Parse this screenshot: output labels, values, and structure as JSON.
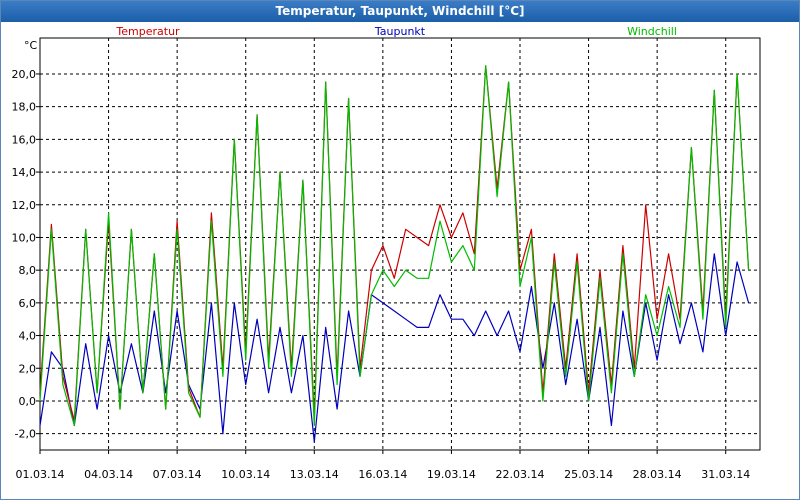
{
  "window": {
    "title": "Temperatur, Taupunkt, Windchill [°C]"
  },
  "colors": {
    "Temperatur": "#cc0000",
    "Taupunkt": "#0000bb",
    "Windchill": "#00bb00",
    "grid": "#000000",
    "title_bar": "#2a6db5"
  },
  "chart_data": {
    "type": "line",
    "title": "Temperatur, Taupunkt, Windchill [°C]",
    "ylabel": "°C",
    "ylim": [
      -3.0,
      22.2
    ],
    "xlim": [
      "01.03.14",
      "02.04.14"
    ],
    "yticks": [
      "-2,0",
      "0,0",
      "2,0",
      "4,0",
      "6,0",
      "8,0",
      "10,0",
      "12,0",
      "14,0",
      "16,0",
      "18,0",
      "20,0"
    ],
    "xticks": [
      "01.03.14",
      "04.03.14",
      "07.03.14",
      "10.03.14",
      "13.03.14",
      "16.03.14",
      "19.03.14",
      "22.03.14",
      "25.03.14",
      "28.03.14",
      "31.03.14"
    ],
    "grid": true,
    "legend": "top",
    "x_unit": "day of month (March 2014), 0.5-day steps starting 01.03.14",
    "x": [
      1.0,
      1.5,
      2.0,
      2.5,
      3.0,
      3.5,
      4.0,
      4.5,
      5.0,
      5.5,
      6.0,
      6.5,
      7.0,
      7.5,
      8.0,
      8.5,
      9.0,
      9.5,
      10.0,
      10.5,
      11.0,
      11.5,
      12.0,
      12.5,
      13.0,
      13.5,
      14.0,
      14.5,
      15.0,
      15.5,
      16.0,
      16.5,
      17.0,
      17.5,
      18.0,
      18.5,
      19.0,
      19.5,
      20.0,
      20.5,
      21.0,
      21.5,
      22.0,
      22.5,
      23.0,
      23.5,
      24.0,
      24.5,
      25.0,
      25.5,
      26.0,
      26.5,
      27.0,
      27.5,
      28.0,
      28.5,
      29.0,
      29.5,
      30.0,
      30.5,
      31.0,
      31.5,
      32.0
    ],
    "series": [
      {
        "name": "Temperatur",
        "values": [
          0.5,
          10.8,
          1.5,
          -1.2,
          10.5,
          0.5,
          11.0,
          -0.5,
          10.5,
          0.5,
          9.0,
          -0.5,
          11.0,
          0.8,
          -1.0,
          11.5,
          2.0,
          16.0,
          3.0,
          17.5,
          2.5,
          14.0,
          2.0,
          13.5,
          -1.0,
          19.5,
          1.5,
          18.5,
          2.0,
          8.0,
          9.5,
          7.5,
          10.5,
          10.0,
          9.5,
          12.0,
          10.0,
          11.5,
          9.0,
          20.5,
          13.0,
          19.5,
          8.0,
          10.5,
          0.5,
          9.0,
          2.0,
          9.0,
          0.5,
          8.0,
          1.0,
          9.5,
          2.0,
          12.0,
          5.0,
          9.0,
          5.0,
          15.5,
          5.5,
          19.0,
          5.0,
          20.0,
          8.0
        ]
      },
      {
        "name": "Taupunkt",
        "values": [
          -1.5,
          3.0,
          2.0,
          -1.5,
          3.5,
          -0.5,
          4.0,
          0.5,
          3.5,
          0.5,
          5.5,
          0.5,
          5.5,
          1.0,
          -0.5,
          6.0,
          -2.0,
          6.0,
          1.0,
          5.0,
          0.5,
          4.5,
          0.5,
          4.0,
          -2.5,
          4.5,
          -0.5,
          5.5,
          1.5,
          6.5,
          6.0,
          5.5,
          5.0,
          4.5,
          4.5,
          6.5,
          5.0,
          5.0,
          4.0,
          5.5,
          4.0,
          5.5,
          3.0,
          7.0,
          2.0,
          6.0,
          1.0,
          5.0,
          0.0,
          4.5,
          -1.5,
          5.5,
          1.5,
          6.0,
          2.5,
          6.5,
          3.5,
          6.0,
          3.0,
          9.0,
          4.0,
          8.5,
          6.0
        ]
      },
      {
        "name": "Windchill",
        "values": [
          0.0,
          10.5,
          1.0,
          -1.5,
          10.5,
          0.5,
          11.5,
          -0.5,
          10.5,
          0.5,
          9.0,
          -0.5,
          10.5,
          0.5,
          -1.0,
          11.0,
          1.5,
          16.0,
          2.5,
          17.5,
          2.0,
          14.0,
          1.5,
          13.5,
          -1.5,
          19.5,
          1.0,
          18.5,
          1.5,
          6.5,
          8.0,
          7.0,
          8.0,
          7.5,
          7.5,
          11.0,
          8.5,
          9.5,
          8.0,
          20.5,
          12.5,
          19.5,
          7.0,
          10.0,
          0.0,
          8.5,
          1.5,
          8.5,
          0.0,
          7.5,
          0.5,
          9.0,
          1.5,
          6.5,
          4.0,
          7.0,
          4.5,
          15.5,
          5.0,
          19.0,
          4.5,
          20.0,
          8.0
        ]
      }
    ]
  }
}
